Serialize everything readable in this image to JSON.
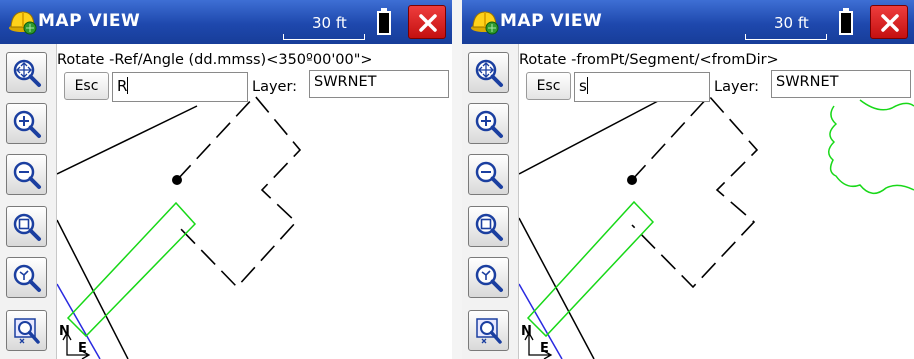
{
  "screens": [
    {
      "title": "MAP VIEW",
      "scale": "30 ft",
      "prompt": "Rotate  -Ref/Angle (dd.mmss)<350º00'00\">",
      "esc_label": "Esc",
      "command_value": "R",
      "layer_label": "Layer:",
      "layer_value": "SWRNET",
      "north_label": "N",
      "east_label": "E"
    },
    {
      "title": "MAP VIEW",
      "scale": "30 ft",
      "prompt": "Rotate  -fromPt/Segment/<fromDir>",
      "esc_label": "Esc",
      "command_value": "s",
      "layer_label": "Layer:",
      "layer_value": "SWRNET",
      "north_label": "N",
      "east_label": "E"
    }
  ],
  "toolbar_icons": [
    "zoom-extents-icon",
    "zoom-in-icon",
    "zoom-out-icon",
    "zoom-window-icon",
    "zoom-previous-icon",
    "pan-icon"
  ],
  "colors": {
    "titlebar": "#1e48ad",
    "close_button": "#d81e1e",
    "green_feature": "#18d818",
    "blue_feature": "#2a2ae0",
    "linework": "#000000"
  }
}
